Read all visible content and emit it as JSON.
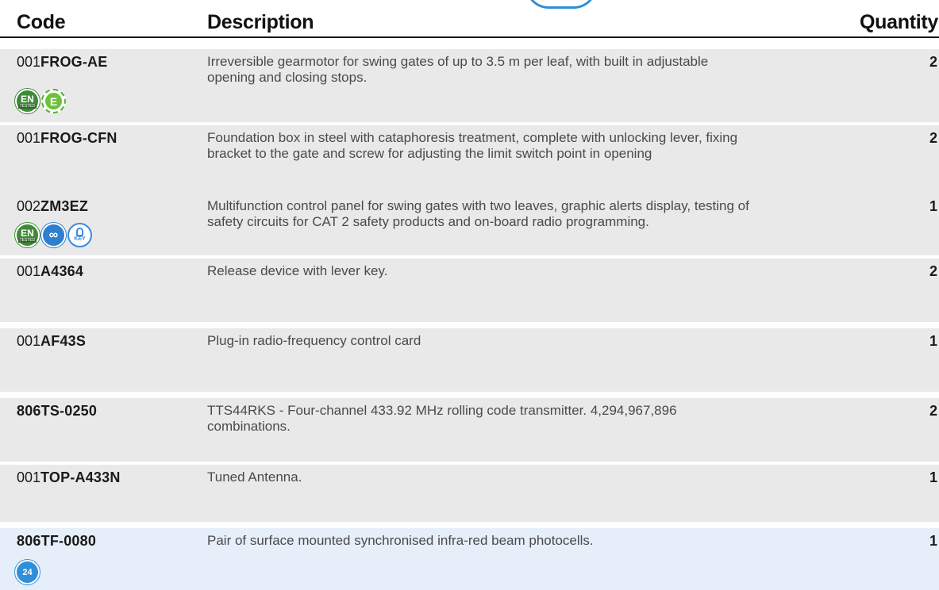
{
  "header": {
    "code": "Code",
    "description": "Description",
    "quantity": "Quantity"
  },
  "rows": [
    {
      "code_prefix": "001",
      "code_main": "FROG-AE",
      "description": "Irreversible gearmotor for swing gates of up to 3.5 m per leaf, with built in adjustable opening and closing stops.",
      "quantity": "2",
      "badges": [
        {
          "icon": "en-tested-icon",
          "text": "EN",
          "sub": "TESTED"
        },
        {
          "icon": "energy-saving-icon",
          "text": "E"
        }
      ]
    },
    {
      "code_prefix": "001",
      "code_main": "FROG-CFN",
      "description": "Foundation box in steel with cataphoresis treatment, complete with unlocking lever, fixing bracket to the gate and screw for adjusting the limit switch point in opening",
      "quantity": "2",
      "badges": []
    },
    {
      "code_prefix": "002",
      "code_main": "ZM3EZ",
      "description": "Multifunction control panel for swing gates with two leaves, graphic alerts display, testing of safety circuits for CAT 2 safety products and on-board radio programming.",
      "quantity": "1",
      "badges": [
        {
          "icon": "en-tested-icon",
          "text": "EN",
          "sub": "TESTED"
        },
        {
          "icon": "connect-icon",
          "text": ""
        },
        {
          "icon": "key-icon",
          "text": "KEY"
        }
      ]
    },
    {
      "code_prefix": "001",
      "code_main": "A4364",
      "description": "Release device with lever key.",
      "quantity": "2",
      "badges": []
    },
    {
      "code_prefix": "001",
      "code_main": "AF43S",
      "description": "Plug-in radio-frequency control card",
      "quantity": "1",
      "badges": []
    },
    {
      "code_prefix": "",
      "code_main": "806TS-0250",
      "description": "TTS44RKS - Four-channel 433.92 MHz rolling code transmitter. 4,294,967,896 combinations.",
      "quantity": "2",
      "badges": []
    },
    {
      "code_prefix": "001",
      "code_main": "TOP-A433N",
      "description": "Tuned Antenna.",
      "quantity": "1",
      "badges": []
    },
    {
      "code_prefix": "",
      "code_main": "806TF-0080",
      "description": "Pair of surface mounted synchronised infra-red beam photocells.",
      "quantity": "1",
      "badges": [
        {
          "icon": "24v-icon",
          "text": "24"
        }
      ]
    }
  ],
  "colors": {
    "row_bg": "#e9e9e9",
    "row_bg_highlight": "#e6eff9",
    "accent_blue": "#2f8fd8",
    "badge_green": "#3e8a36"
  }
}
